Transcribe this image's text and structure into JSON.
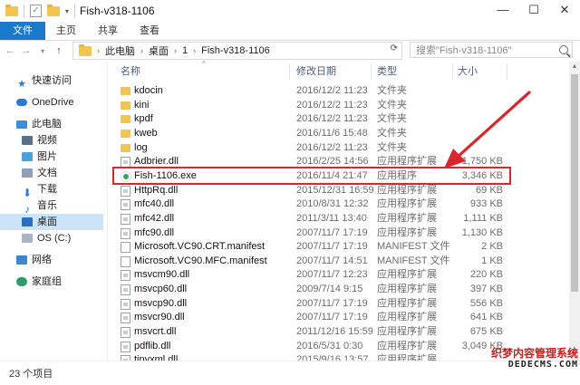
{
  "window": {
    "title": "Fish-v318-1106",
    "controls": [
      "—",
      "☐",
      "✕"
    ]
  },
  "ribbon": {
    "tabs": [
      "文件",
      "主页",
      "共享",
      "查看"
    ]
  },
  "address": {
    "breadcrumbs": [
      "此电脑",
      "桌面",
      "1",
      "Fish-v318-1106"
    ],
    "search_placeholder": "搜索\"Fish-v318-1106\""
  },
  "navpane": {
    "items": [
      {
        "label": "快速访问",
        "icon": "star-icon"
      },
      {
        "label": "OneDrive",
        "icon": "cloud-icon"
      },
      {
        "label": "此电脑",
        "icon": "computer-icon"
      },
      {
        "label": "视频",
        "icon": "video-icon"
      },
      {
        "label": "图片",
        "icon": "picture-icon"
      },
      {
        "label": "文档",
        "icon": "document-icon"
      },
      {
        "label": "下载",
        "icon": "download-icon"
      },
      {
        "label": "音乐",
        "icon": "music-icon"
      },
      {
        "label": "桌面",
        "icon": "desktop-icon"
      },
      {
        "label": "OS (C:)",
        "icon": "drive-icon"
      },
      {
        "label": "网络",
        "icon": "network-icon"
      },
      {
        "label": "家庭组",
        "icon": "homegroup-icon"
      }
    ]
  },
  "columns": {
    "name": "名称",
    "date": "修改日期",
    "type": "类型",
    "size": "大小"
  },
  "files": [
    {
      "name": "kdocin",
      "date": "2016/12/2 11:23",
      "type": "文件夹",
      "size": "",
      "kind": "folder"
    },
    {
      "name": "kini",
      "date": "2016/12/2 11:23",
      "type": "文件夹",
      "size": "",
      "kind": "folder"
    },
    {
      "name": "kpdf",
      "date": "2016/12/2 11:23",
      "type": "文件夹",
      "size": "",
      "kind": "folder"
    },
    {
      "name": "kweb",
      "date": "2016/11/6 15:48",
      "type": "文件夹",
      "size": "",
      "kind": "folder"
    },
    {
      "name": "log",
      "date": "2016/12/2 11:23",
      "type": "文件夹",
      "size": "",
      "kind": "folder"
    },
    {
      "name": "Adbrier.dll",
      "date": "2016/2/25 14:56",
      "type": "应用程序扩展",
      "size": "1,750 KB",
      "kind": "dll"
    },
    {
      "name": "Fish-1106.exe",
      "date": "2016/11/4 21:47",
      "type": "应用程序",
      "size": "3,346 KB",
      "kind": "exe"
    },
    {
      "name": "HttpRq.dll",
      "date": "2015/12/31 16:59",
      "type": "应用程序扩展",
      "size": "69 KB",
      "kind": "dll"
    },
    {
      "name": "mfc40.dll",
      "date": "2010/8/31 12:32",
      "type": "应用程序扩展",
      "size": "933 KB",
      "kind": "dll"
    },
    {
      "name": "mfc42.dll",
      "date": "2011/3/11 13:40",
      "type": "应用程序扩展",
      "size": "1,111 KB",
      "kind": "dll"
    },
    {
      "name": "mfc90.dll",
      "date": "2007/11/7 17:19",
      "type": "应用程序扩展",
      "size": "1,130 KB",
      "kind": "dll"
    },
    {
      "name": "Microsoft.VC90.CRT.manifest",
      "date": "2007/11/7 17:19",
      "type": "MANIFEST 文件",
      "size": "2 KB",
      "kind": "manifest"
    },
    {
      "name": "Microsoft.VC90.MFC.manifest",
      "date": "2007/11/7 14:51",
      "type": "MANIFEST 文件",
      "size": "1 KB",
      "kind": "manifest"
    },
    {
      "name": "msvcm90.dll",
      "date": "2007/11/7 12:23",
      "type": "应用程序扩展",
      "size": "220 KB",
      "kind": "dll"
    },
    {
      "name": "msvcp60.dll",
      "date": "2009/7/14 9:15",
      "type": "应用程序扩展",
      "size": "397 KB",
      "kind": "dll"
    },
    {
      "name": "msvcp90.dll",
      "date": "2007/11/7 17:19",
      "type": "应用程序扩展",
      "size": "556 KB",
      "kind": "dll"
    },
    {
      "name": "msvcr90.dll",
      "date": "2007/11/7 17:19",
      "type": "应用程序扩展",
      "size": "641 KB",
      "kind": "dll"
    },
    {
      "name": "msvcrt.dll",
      "date": "2011/12/16 15:59",
      "type": "应用程序扩展",
      "size": "675 KB",
      "kind": "dll"
    },
    {
      "name": "pdflib.dll",
      "date": "2016/5/31 0:30",
      "type": "应用程序扩展",
      "size": "3,049 KB",
      "kind": "dll"
    },
    {
      "name": "tinyxml.dll",
      "date": "2015/9/16 13:57",
      "type": "应用程序扩展",
      "size": "",
      "kind": "dll"
    }
  ],
  "highlighted_file": "Fish-1106.exe",
  "annotation": {
    "color": "#d9262b"
  },
  "status": {
    "item_count": "23 个项目"
  },
  "watermark": {
    "line1": "织梦内容管理系统",
    "line2": "DEDECMS.COM"
  },
  "colors": {
    "accent": "#1979ca",
    "selection": "#cce4f7"
  }
}
